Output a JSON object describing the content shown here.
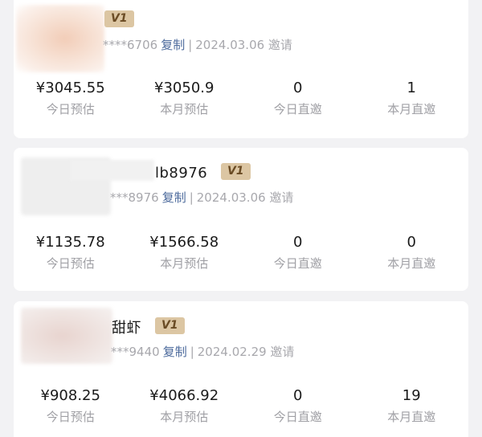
{
  "members": [
    {
      "name": "",
      "badge": "V1",
      "phone_masked": "****6706",
      "copy_label": "复制",
      "separator": "|",
      "invite_date": "2024.03.06 邀请",
      "stats": [
        {
          "value": "¥3045.55",
          "label": "今日预估"
        },
        {
          "value": "¥3050.9",
          "label": "本月预估"
        },
        {
          "value": "0",
          "label": "今日直邀"
        },
        {
          "value": "1",
          "label": "本月直邀"
        }
      ]
    },
    {
      "name": "lb8976",
      "badge": "V1",
      "phone_masked": "***8976",
      "copy_label": "复制",
      "separator": "|",
      "invite_date": "2024.03.06 邀请",
      "stats": [
        {
          "value": "¥1135.78",
          "label": "今日预估"
        },
        {
          "value": "¥1566.58",
          "label": "本月预估"
        },
        {
          "value": "0",
          "label": "今日直邀"
        },
        {
          "value": "0",
          "label": "本月直邀"
        }
      ]
    },
    {
      "name": "甜虾",
      "badge": "V1",
      "phone_masked": "***9440",
      "copy_label": "复制",
      "separator": "|",
      "invite_date": "2024.02.29 邀请",
      "stats": [
        {
          "value": "¥908.25",
          "label": "今日预估"
        },
        {
          "value": "¥4066.92",
          "label": "本月预估"
        },
        {
          "value": "0",
          "label": "今日直邀"
        },
        {
          "value": "19",
          "label": "本月直邀"
        }
      ]
    }
  ]
}
